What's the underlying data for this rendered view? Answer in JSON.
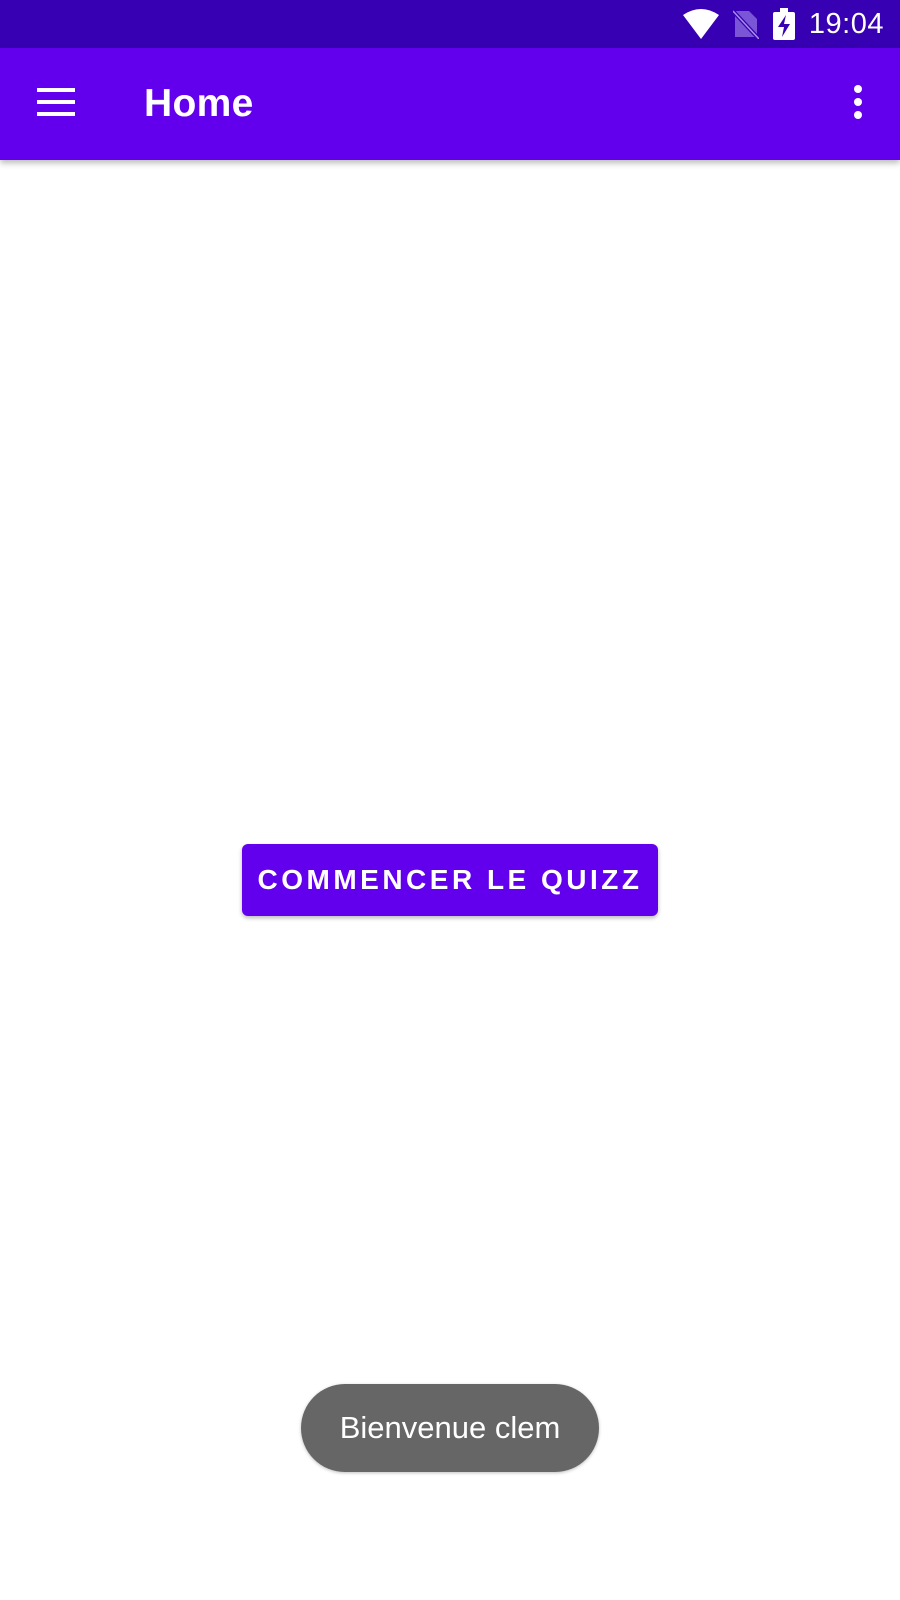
{
  "status_bar": {
    "time": "19:04",
    "icons": [
      "wifi-icon",
      "no-sim-icon",
      "battery-charging-icon"
    ],
    "background": "#3700B3"
  },
  "app_bar": {
    "title": "Home",
    "navigation_icon": "menu-icon",
    "action_icon": "more-vert-icon",
    "background": "#6200EE"
  },
  "main": {
    "start_button_label": "COMMENCER LE QUIZZ",
    "button_color": "#6200EE"
  },
  "toast": {
    "message": "Bienvenue clem",
    "background": "#666666"
  }
}
